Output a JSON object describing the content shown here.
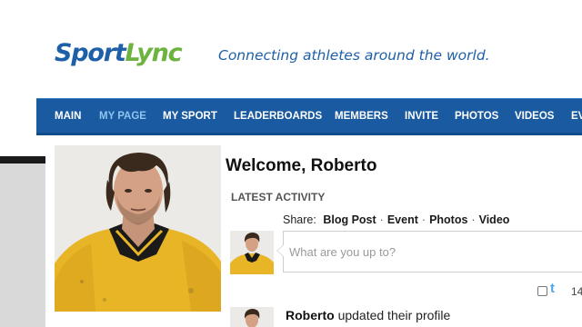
{
  "header": {
    "logo_part1": "Sport",
    "logo_part2": "Lync",
    "tagline": "Connecting athletes around the world."
  },
  "nav": {
    "items": [
      {
        "label": "MAIN"
      },
      {
        "label": "MY PAGE",
        "active": true
      },
      {
        "label": "MY SPORT"
      },
      {
        "label": "LEADERBOARDS"
      },
      {
        "label": "MEMBERS"
      },
      {
        "label": "INVITE"
      },
      {
        "label": "PHOTOS"
      },
      {
        "label": "VIDEOS"
      },
      {
        "label": "EV"
      }
    ]
  },
  "profile": {
    "welcome": "Welcome, Roberto",
    "latest_activity": "LATEST ACTIVITY"
  },
  "share": {
    "label": "Share:",
    "options": [
      "Blog Post",
      "Event",
      "Photos",
      "Video"
    ],
    "separator": "·",
    "placeholder": "What are you up to?"
  },
  "twitter": {
    "icon": "twitter-icon",
    "count": "14"
  },
  "activity": [
    {
      "user": "Roberto",
      "action": "updated their profile"
    }
  ],
  "colors": {
    "brand_blue": "#1e60a8",
    "brand_green": "#6cb33f",
    "nav_bg": "#1a5aa0",
    "nav_active": "#8fc3f0"
  }
}
